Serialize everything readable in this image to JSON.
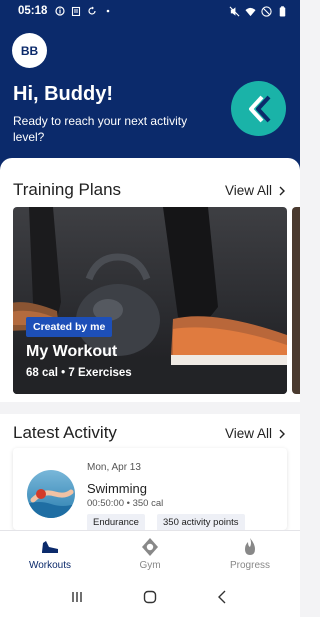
{
  "status_bar": {
    "time": "05:18",
    "icons": [
      "info-icon",
      "clipboard-icon",
      "sync-icon",
      "dot-icon"
    ],
    "right_icons": [
      "mute-icon",
      "wifi-icon",
      "dnd-icon",
      "battery-icon"
    ]
  },
  "header": {
    "avatar_initials": "BB",
    "greeting": "Hi, Buddy!",
    "subtitle": "Ready to reach your next activity level?",
    "brand_icon": "chevron-logo-icon"
  },
  "training_plans": {
    "title": "Training Plans",
    "view_all": "View All",
    "card": {
      "badge": "Created by me",
      "name": "My Workout",
      "meta": "68 cal • 7 Exercises"
    }
  },
  "latest_activity": {
    "title": "Latest Activity",
    "view_all": "View All",
    "item": {
      "date": "Mon, Apr 13",
      "name": "Swimming",
      "meta": "00:50:00 • 350 cal",
      "chips": [
        "Endurance",
        "350 activity points"
      ]
    }
  },
  "bottom_nav": {
    "items": [
      {
        "label": "Workouts",
        "icon": "shoe-icon",
        "active": true
      },
      {
        "label": "Gym",
        "icon": "location-pin-icon",
        "active": false
      },
      {
        "label": "Progress",
        "icon": "flame-icon",
        "active": false
      }
    ]
  },
  "system_nav": [
    "recents-icon",
    "home-icon",
    "back-icon"
  ],
  "colors": {
    "header_bg": "#0b2a6b",
    "accent": "#1d4fb8",
    "brand": "#1ab3a8"
  }
}
